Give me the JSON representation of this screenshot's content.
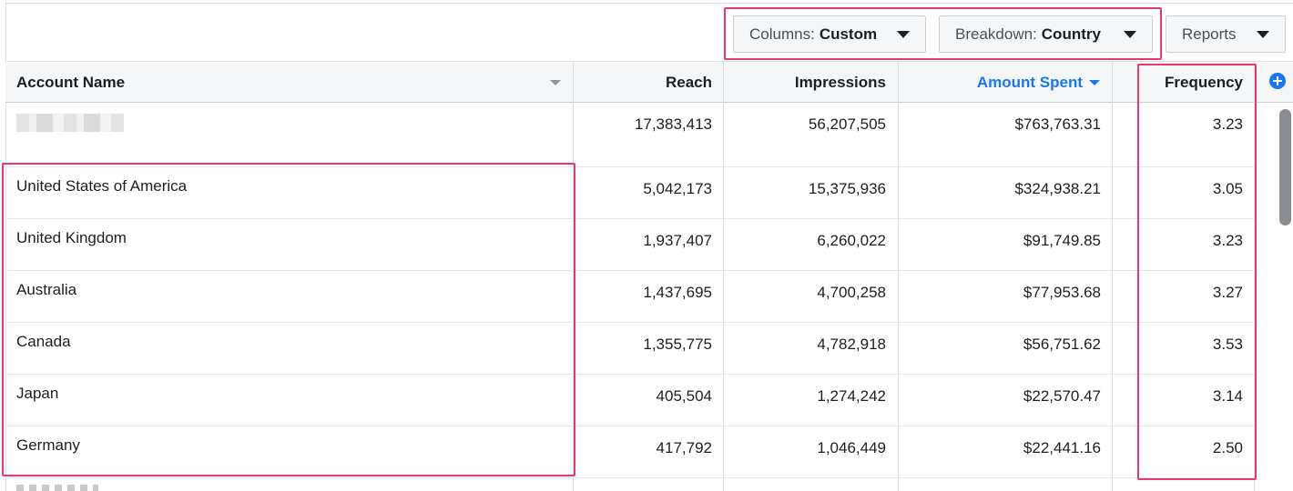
{
  "toolbar": {
    "columns_label": "Columns:",
    "columns_value": "Custom",
    "breakdown_label": "Breakdown:",
    "breakdown_value": "Country",
    "reports_label": "Reports"
  },
  "table": {
    "headers": {
      "account_name": "Account Name",
      "reach": "Reach",
      "impressions": "Impressions",
      "amount_spent": "Amount Spent",
      "frequency": "Frequency"
    },
    "total_row": {
      "reach": "17,383,413",
      "impressions": "56,207,505",
      "amount_spent": "$763,763.31",
      "frequency": "3.23"
    },
    "rows": [
      {
        "name": "United States of America",
        "reach": "5,042,173",
        "impressions": "15,375,936",
        "amount_spent": "$324,938.21",
        "frequency": "3.05"
      },
      {
        "name": "United Kingdom",
        "reach": "1,937,407",
        "impressions": "6,260,022",
        "amount_spent": "$91,749.85",
        "frequency": "3.23"
      },
      {
        "name": "Australia",
        "reach": "1,437,695",
        "impressions": "4,700,258",
        "amount_spent": "$77,953.68",
        "frequency": "3.27"
      },
      {
        "name": "Canada",
        "reach": "1,355,775",
        "impressions": "4,782,918",
        "amount_spent": "$56,751.62",
        "frequency": "3.53"
      },
      {
        "name": "Japan",
        "reach": "405,504",
        "impressions": "1,274,242",
        "amount_spent": "$22,570.47",
        "frequency": "3.14"
      },
      {
        "name": "Germany",
        "reach": "417,792",
        "impressions": "1,046,449",
        "amount_spent": "$22,441.16",
        "frequency": "2.50"
      }
    ]
  },
  "colors": {
    "highlight": "#e8386f",
    "accent_link": "#1877f2",
    "header_bg": "#f5f6f7"
  },
  "icons": {
    "dropdown": "caret-down-icon",
    "add_column": "plus-circle-icon",
    "sort": "sort-desc-icon"
  }
}
